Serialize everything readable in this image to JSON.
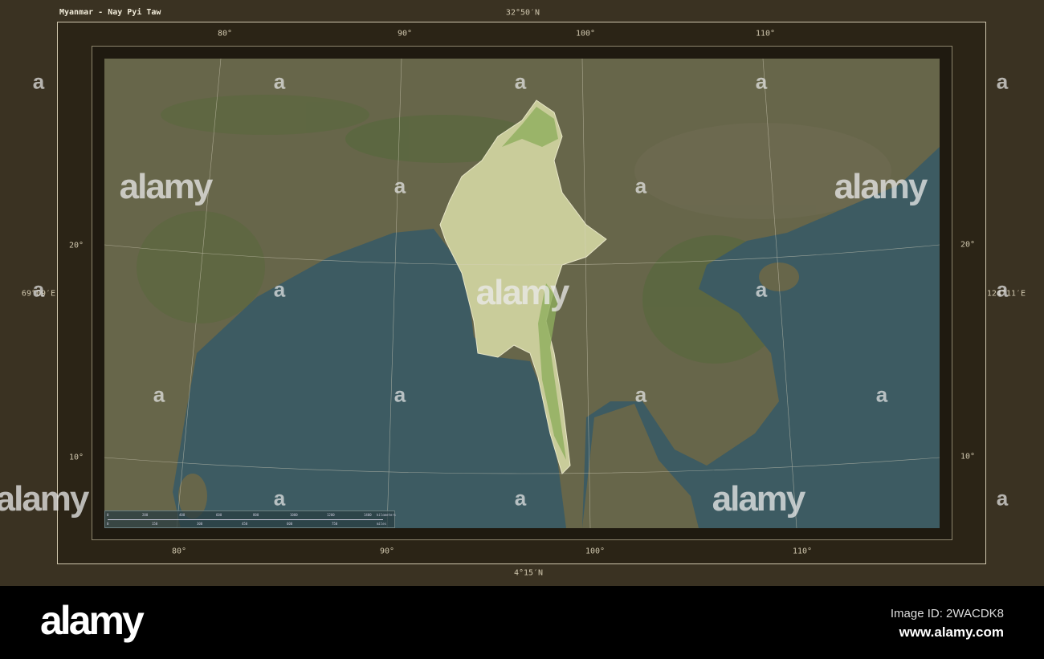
{
  "title": "Myanmar - Nay Pyi Taw",
  "extent": {
    "north": "32°50′N",
    "south": "4°15′N",
    "west": "69°09′E",
    "east": "124°11′E"
  },
  "graticule": {
    "top_longitudes": [
      "80°",
      "90°",
      "100°",
      "110°"
    ],
    "bottom_longitudes": [
      "80°",
      "90°",
      "100°",
      "110°"
    ],
    "left_latitudes": [
      "20°",
      "10°"
    ],
    "right_latitudes": [
      "20°",
      "10°"
    ]
  },
  "scale_bar": {
    "km_ticks": [
      "0",
      "200",
      "400",
      "600",
      "800",
      "1000",
      "1200",
      "1400"
    ],
    "km_unit": "kilometers",
    "mile_ticks": [
      "0",
      "150",
      "300",
      "450",
      "600",
      "750"
    ],
    "mile_unit": "miles"
  },
  "colors": {
    "sea": "#3d5b62",
    "land": "#67664a",
    "highlight": "#c9cc9a",
    "highlight_green": "#8fae5c",
    "frame": "#3a3222"
  },
  "watermark": {
    "brand": "alamy",
    "mark": "a"
  },
  "banner": {
    "logo": "alamy",
    "image_id": "Image ID: 2WACDK8",
    "url": "www.alamy.com"
  }
}
